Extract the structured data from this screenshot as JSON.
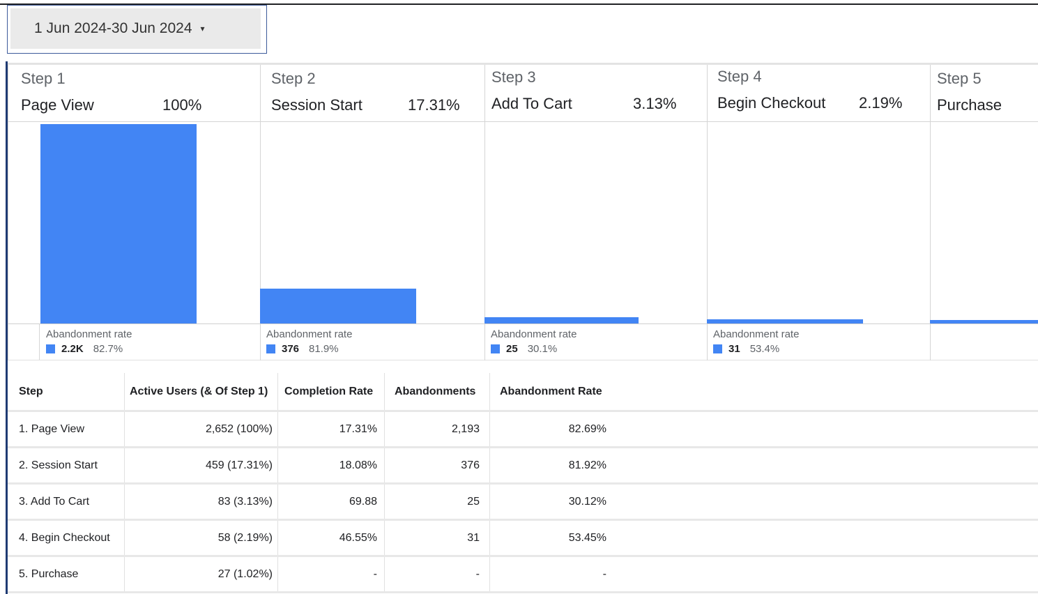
{
  "date_range": {
    "label": "1 Jun 2024-30 Jun 2024",
    "caret": "▾"
  },
  "chart_data": {
    "type": "bar",
    "title": "",
    "categories": [
      "Page View",
      "Session Start",
      "Add To Cart",
      "Begin Checkout",
      "Purchase"
    ],
    "steps": [
      {
        "step_label": "Step 1",
        "name": "Page View",
        "pct": "100%",
        "active_users": 2652,
        "abandon_title": "Abandonment rate",
        "abandon_count": "2.2K",
        "abandon_rate": "82.7%"
      },
      {
        "step_label": "Step 2",
        "name": "Session Start",
        "pct": "17.31%",
        "active_users": 459,
        "abandon_title": "Abandonment rate",
        "abandon_count": "376",
        "abandon_rate": "81.9%"
      },
      {
        "step_label": "Step 3",
        "name": "Add To Cart",
        "pct": "3.13%",
        "active_users": 83,
        "abandon_title": "Abandonment rate",
        "abandon_count": "25",
        "abandon_rate": "30.1%"
      },
      {
        "step_label": "Step 4",
        "name": "Begin Checkout",
        "pct": "2.19%",
        "active_users": 58,
        "abandon_title": "Abandonment rate",
        "abandon_count": "31",
        "abandon_rate": "53.4%"
      },
      {
        "step_label": "Step 5",
        "name": "Purchase",
        "pct": "",
        "active_users": 27,
        "abandon_title": "",
        "abandon_count": "",
        "abandon_rate": ""
      }
    ],
    "values": [
      2652,
      459,
      83,
      58,
      27
    ],
    "ylim": [
      0,
      2652
    ],
    "grid": false,
    "bar_color": "#4285f4"
  },
  "table": {
    "headers": [
      "Step",
      "Active Users (& Of Step 1)",
      "Completion Rate",
      "Abandonments",
      "Abandonment Rate"
    ],
    "rows": [
      [
        "1. Page View",
        "2,652 (100%)",
        "17.31%",
        "2,193",
        "82.69%"
      ],
      [
        "2. Session Start",
        "459 (17.31%)",
        "18.08%",
        "376",
        "81.92%"
      ],
      [
        "3. Add To Cart",
        "83 (3.13%)",
        "69.88",
        "25",
        "30.12%"
      ],
      [
        "4. Begin Checkout",
        "58 (2.19%)",
        "46.55%",
        "31",
        "53.45%"
      ],
      [
        "5. Purchase",
        "27 (1.02%)",
        "-",
        "-",
        "-"
      ]
    ]
  }
}
